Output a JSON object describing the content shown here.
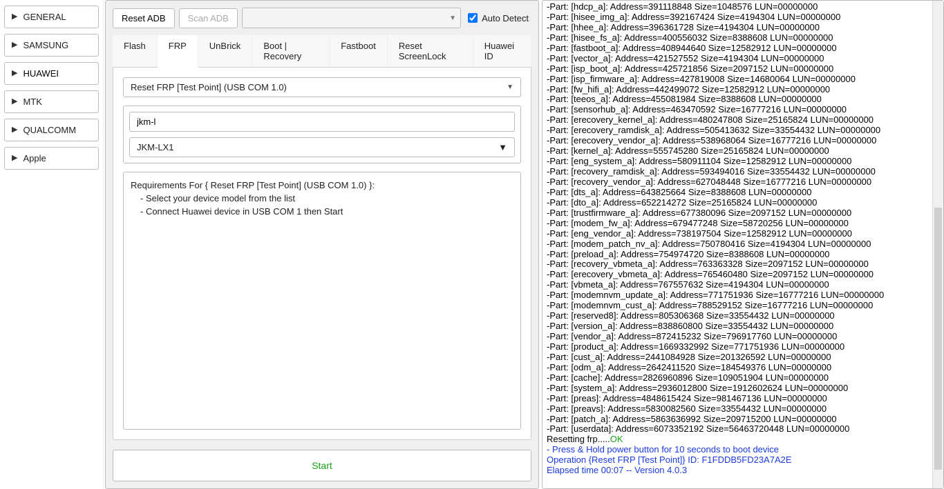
{
  "sidebar": {
    "items": [
      {
        "label": "GENERAL"
      },
      {
        "label": "SAMSUNG"
      },
      {
        "label": "HUAWEI"
      },
      {
        "label": "MTK"
      },
      {
        "label": "QUALCOMM"
      },
      {
        "label": "Apple"
      }
    ],
    "activeIndex": 2
  },
  "toolbar": {
    "reset_adb": "Reset ADB",
    "scan_adb": "Scan ADB",
    "auto_detect": "Auto Detect",
    "auto_detect_checked": true
  },
  "tabs": [
    {
      "label": "Flash"
    },
    {
      "label": "FRP"
    },
    {
      "label": "UnBrick"
    },
    {
      "label": "Boot | Recovery"
    },
    {
      "label": "Fastboot"
    },
    {
      "label": "Reset ScreenLock"
    },
    {
      "label": "Huawei ID"
    }
  ],
  "tabActiveIndex": 1,
  "frp": {
    "operation_select": "Reset FRP [Test Point] (USB COM 1.0)",
    "filter_value": "jkm-l",
    "model_select": "JKM-LX1",
    "requirements_title": "Requirements For { Reset FRP [Test Point] (USB COM 1.0) }:",
    "req_lines": [
      "- Select your device model from the list",
      "- Connect Huawei device in USB COM 1 then Start"
    ]
  },
  "start_label": "Start",
  "log": {
    "lines": [
      "-Part: [hdcp_a]: Address=391118848 Size=1048576 LUN=00000000",
      "-Part: [hisee_img_a]: Address=392167424 Size=4194304 LUN=00000000",
      "-Part: [hhee_a]: Address=396361728 Size=4194304 LUN=00000000",
      "-Part: [hisee_fs_a]: Address=400556032 Size=8388608 LUN=00000000",
      "-Part: [fastboot_a]: Address=408944640 Size=12582912 LUN=00000000",
      "-Part: [vector_a]: Address=421527552 Size=4194304 LUN=00000000",
      "-Part: [isp_boot_a]: Address=425721856 Size=2097152 LUN=00000000",
      "-Part: [isp_firmware_a]: Address=427819008 Size=14680064 LUN=00000000",
      "-Part: [fw_hifi_a]: Address=442499072 Size=12582912 LUN=00000000",
      "-Part: [teeos_a]: Address=455081984 Size=8388608 LUN=00000000",
      "-Part: [sensorhub_a]: Address=463470592 Size=16777216 LUN=00000000",
      "-Part: [erecovery_kernel_a]: Address=480247808 Size=25165824 LUN=00000000",
      "-Part: [erecovery_ramdisk_a]: Address=505413632 Size=33554432 LUN=00000000",
      "-Part: [erecovery_vendor_a]: Address=538968064 Size=16777216 LUN=00000000",
      "-Part: [kernel_a]: Address=555745280 Size=25165824 LUN=00000000",
      "-Part: [eng_system_a]: Address=580911104 Size=12582912 LUN=00000000",
      "-Part: [recovery_ramdisk_a]: Address=593494016 Size=33554432 LUN=00000000",
      "-Part: [recovery_vendor_a]: Address=627048448 Size=16777216 LUN=00000000",
      "-Part: [dts_a]: Address=643825664 Size=8388608 LUN=00000000",
      "-Part: [dto_a]: Address=652214272 Size=25165824 LUN=00000000",
      "-Part: [trustfirmware_a]: Address=677380096 Size=2097152 LUN=00000000",
      "-Part: [modem_fw_a]: Address=679477248 Size=58720256 LUN=00000000",
      "-Part: [eng_vendor_a]: Address=738197504 Size=12582912 LUN=00000000",
      "-Part: [modem_patch_nv_a]: Address=750780416 Size=4194304 LUN=00000000",
      "-Part: [preload_a]: Address=754974720 Size=8388608 LUN=00000000",
      "-Part: [recovery_vbmeta_a]: Address=763363328 Size=2097152 LUN=00000000",
      "-Part: [erecovery_vbmeta_a]: Address=765460480 Size=2097152 LUN=00000000",
      "-Part: [vbmeta_a]: Address=767557632 Size=4194304 LUN=00000000",
      "-Part: [modemnvm_update_a]: Address=771751936 Size=16777216 LUN=00000000",
      "-Part: [modemnvm_cust_a]: Address=788529152 Size=16777216 LUN=00000000",
      "-Part: [reserved8]: Address=805306368 Size=33554432 LUN=00000000",
      "-Part: [version_a]: Address=838860800 Size=33554432 LUN=00000000",
      "-Part: [vendor_a]: Address=872415232 Size=796917760 LUN=00000000",
      "-Part: [product_a]: Address=1669332992 Size=771751936 LUN=00000000",
      "-Part: [cust_a]: Address=2441084928 Size=201326592 LUN=00000000",
      "-Part: [odm_a]: Address=2642411520 Size=184549376 LUN=00000000",
      "-Part: [cache]: Address=2826960896 Size=109051904 LUN=00000000",
      "-Part: [system_a]: Address=2936012800 Size=1912602624 LUN=00000000",
      "-Part: [preas]: Address=4848615424 Size=981467136 LUN=00000000",
      "-Part: [preavs]: Address=5830082560 Size=33554432 LUN=00000000",
      "-Part: [patch_a]: Address=5863636992 Size=209715200 LUN=00000000",
      "-Part: [userdata]: Address=6073352192 Size=56463720448 LUN=00000000"
    ],
    "resetting_prefix": "Resetting frp.....",
    "ok": "OK",
    "blue_lines": [
      "- Press & Hold power button for 10 seconds to boot device",
      "Operation {Reset FRP [Test Point]} ID: F1FDDB5FD23A7A2E",
      "Elapsed time 00:07 -- Version 4.0.3"
    ]
  }
}
